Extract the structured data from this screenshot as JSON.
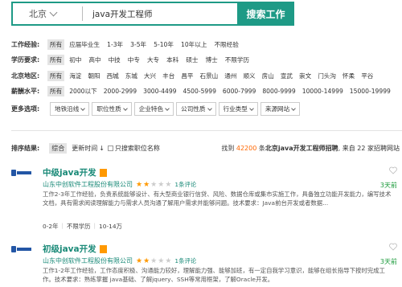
{
  "search": {
    "city": "北京",
    "query": "java开发工程师",
    "button": "搜索工作"
  },
  "filters": [
    {
      "label": "工作经验:",
      "options": [
        "所有",
        "应届毕业生",
        "1-3年",
        "3-5年",
        "5-10年",
        "10年以上",
        "不限经验"
      ]
    },
    {
      "label": "学历要求:",
      "options": [
        "所有",
        "初中",
        "高中",
        "中技",
        "中专",
        "大专",
        "本科",
        "硕士",
        "博士",
        "不限学历"
      ]
    },
    {
      "label": "北京地区:",
      "options": [
        "所有",
        "海淀",
        "朝阳",
        "西城",
        "东城",
        "大兴",
        "丰台",
        "昌平",
        "石景山",
        "通州",
        "顺义",
        "房山",
        "宣武",
        "崇文",
        "门头沟",
        "怀柔",
        "平谷"
      ]
    },
    {
      "label": "薪酬水平:",
      "options": [
        "所有",
        "2000以下",
        "2000-2999",
        "3000-4499",
        "4500-5999",
        "6000-7999",
        "8000-9999",
        "10000-14999",
        "15000-19999"
      ]
    }
  ],
  "more_options": {
    "label": "更多选项:",
    "dropdowns": [
      "地铁沿线",
      "职位性质",
      "企业特色",
      "公司性质",
      "行业类型",
      "来源网站"
    ]
  },
  "sort": {
    "label": "排序结果:",
    "comprehensive": "综合",
    "update_time": "更新时间",
    "arrow": "↓",
    "only_rated": "只搜索职位名称",
    "result_prefix": "找到",
    "result_count": "42200",
    "result_mid": "条",
    "result_query": "北京java开发工程师招聘",
    "result_suffix": ", 来自 22 家招聘网站"
  },
  "jobs": [
    {
      "title": "中级java开发",
      "company": "山东中创软件工程股份有限公司",
      "rating": 2,
      "reviews": "1条评论",
      "days": "3天前",
      "desc": "工作2-3年工作经验，负责系统能够设计、有大型商业银行信贷、风险、数据仓库或集市实施工作，具备独立功能开发能力，编写技术文档，具有需求阅读理解能力与需求人员沟通了解用户需求并能够问题。技术要求：Java前台开发或者数据...",
      "experience": "0-2年",
      "education": "不限学历",
      "salary": "10-14万"
    },
    {
      "title": "初级java开发",
      "company": "山东中创软件工程股份有限公司",
      "rating": 2,
      "reviews": "1条评论",
      "days": "3天前",
      "desc": "工作1-2年工作经验，工作态度积极、沟通能力较好，理解能力强、能够加班，有一定自我学习意识，能够在组长指导下按时完成工作。技术要求：熟练掌握 java基础、了解jquery、SSH等常用框架，了解Oracle开发。"
    }
  ],
  "colors": {
    "accent": "#1e9a86",
    "link": "#1a8a78",
    "count": "#ff6600",
    "days": "#1a9a3a",
    "star": "#ff9900"
  }
}
